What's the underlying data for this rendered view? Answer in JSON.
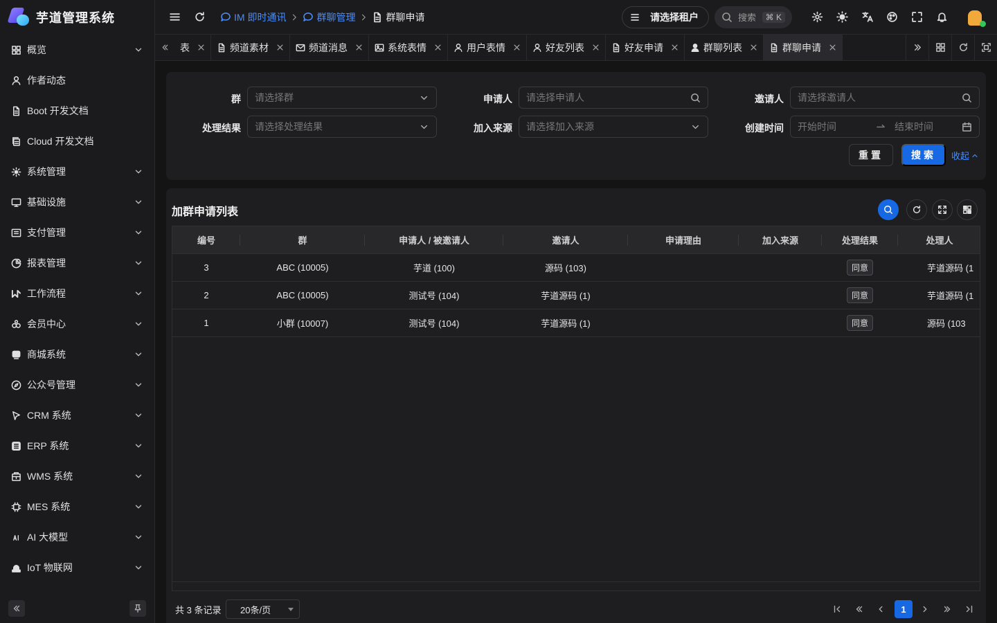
{
  "app": {
    "title": "芋道管理系统"
  },
  "sidebar": {
    "items": [
      {
        "label": "概览",
        "icon": "dashboard-icon",
        "expandable": true
      },
      {
        "label": "作者动态",
        "icon": "user-icon",
        "expandable": false
      },
      {
        "label": "Boot 开发文档",
        "icon": "document-icon",
        "expandable": false
      },
      {
        "label": "Cloud 开发文档",
        "icon": "document-copy-icon",
        "expandable": false
      },
      {
        "label": "系统管理",
        "icon": "gear-icon",
        "expandable": true
      },
      {
        "label": "基础设施",
        "icon": "monitor-icon",
        "expandable": true
      },
      {
        "label": "支付管理",
        "icon": "payment-icon",
        "expandable": true
      },
      {
        "label": "报表管理",
        "icon": "pie-chart-icon",
        "expandable": true
      },
      {
        "label": "工作流程",
        "icon": "workflow-icon",
        "expandable": true
      },
      {
        "label": "会员中心",
        "icon": "members-icon",
        "expandable": true
      },
      {
        "label": "商城系统",
        "icon": "shop-icon",
        "expandable": true
      },
      {
        "label": "公众号管理",
        "icon": "compass-icon",
        "expandable": true
      },
      {
        "label": "CRM 系统",
        "icon": "crm-icon",
        "expandable": true
      },
      {
        "label": "ERP 系统",
        "icon": "erp-icon",
        "expandable": true
      },
      {
        "label": "WMS 系统",
        "icon": "warehouse-icon",
        "expandable": true
      },
      {
        "label": "MES 系统",
        "icon": "chip-icon",
        "expandable": true
      },
      {
        "label": "AI 大模型",
        "icon": "ai-icon",
        "expandable": true
      },
      {
        "label": "IoT 物联网",
        "icon": "iot-icon",
        "expandable": true
      }
    ]
  },
  "header": {
    "breadcrumb": [
      {
        "label": "IM 即时通讯",
        "icon": "chat-icon"
      },
      {
        "label": "群聊管理",
        "icon": "chat-bubbles-icon"
      },
      {
        "label": "群聊申请",
        "icon": "document-icon"
      }
    ],
    "tenant_label": "请选择租户",
    "search_placeholder": "搜索",
    "search_shortcut": "⌘ K"
  },
  "tabs": [
    {
      "label": "表",
      "icon": "",
      "active": false
    },
    {
      "label": "频道素材",
      "icon": "document-icon",
      "active": false
    },
    {
      "label": "频道消息",
      "icon": "mail-icon",
      "active": false
    },
    {
      "label": "系统表情",
      "icon": "image-icon",
      "active": false
    },
    {
      "label": "用户表情",
      "icon": "user-icon",
      "active": false
    },
    {
      "label": "好友列表",
      "icon": "user-icon",
      "active": false
    },
    {
      "label": "好友申请",
      "icon": "document-icon",
      "active": false
    },
    {
      "label": "群聊列表",
      "icon": "user-filled-icon",
      "active": false
    },
    {
      "label": "群聊申请",
      "icon": "document-icon",
      "active": true
    }
  ],
  "filters": {
    "group": {
      "label": "群",
      "placeholder": "请选择群"
    },
    "applicant": {
      "label": "申请人",
      "placeholder": "请选择申请人"
    },
    "inviter": {
      "label": "邀请人",
      "placeholder": "请选择邀请人"
    },
    "result": {
      "label": "处理结果",
      "placeholder": "请选择处理结果"
    },
    "source": {
      "label": "加入来源",
      "placeholder": "请选择加入来源"
    },
    "created": {
      "label": "创建时间",
      "start_placeholder": "开始时间",
      "end_placeholder": "结束时间"
    },
    "reset_label": "重置",
    "search_label": "搜索",
    "collapse_label": "收起"
  },
  "table": {
    "title": "加群申请列表",
    "columns": [
      "编号",
      "群",
      "申请人 / 被邀请人",
      "邀请人",
      "申请理由",
      "加入来源",
      "处理结果",
      "处理人"
    ],
    "rows": [
      [
        "3",
        "ABC (10005)",
        "芋道 (100)",
        "源码 (103)",
        "",
        "",
        "同意",
        "芋道源码 (1"
      ],
      [
        "2",
        "ABC (10005)",
        "测试号 (104)",
        "芋道源码 (1)",
        "",
        "",
        "同意",
        "芋道源码 (1"
      ],
      [
        "1",
        "小群 (10007)",
        "测试号 (104)",
        "芋道源码 (1)",
        "",
        "",
        "同意",
        "源码 (103"
      ]
    ]
  },
  "pagination": {
    "total_text": "共 3 条记录",
    "page_size": "20条/页",
    "current_page": "1"
  },
  "colors": {
    "accent": "#1769e3",
    "link": "#4a8cf7",
    "background": "#141414",
    "panel": "#1e1e20"
  }
}
